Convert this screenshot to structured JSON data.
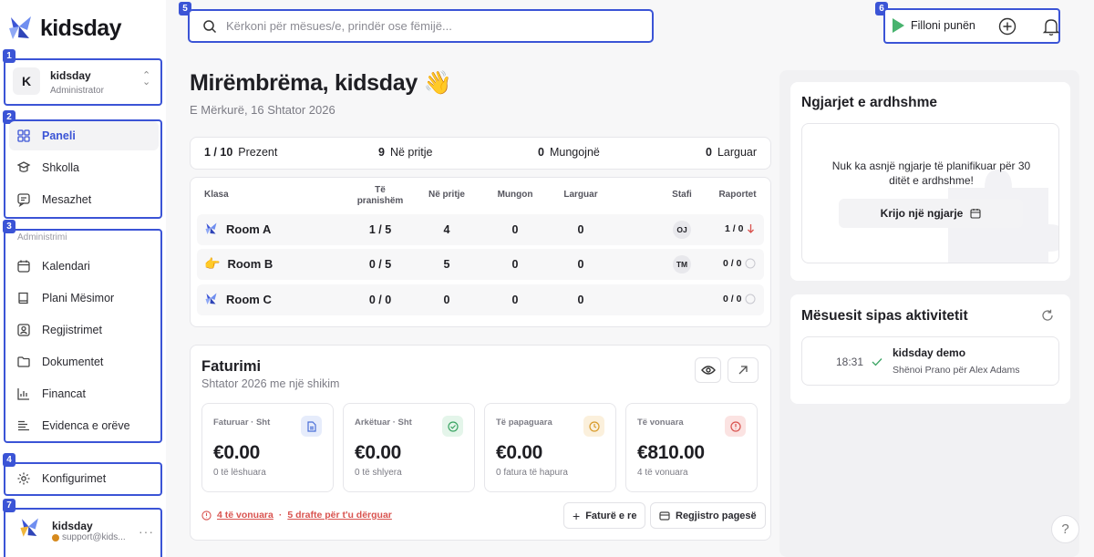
{
  "app": {
    "logo_text": "kidsday"
  },
  "annotations": [
    "1",
    "2",
    "3",
    "4",
    "5",
    "6",
    "7"
  ],
  "account": {
    "initial": "K",
    "name": "kidsday",
    "role": "Administrator"
  },
  "nav_main": [
    {
      "label": "Paneli",
      "icon": "grid-icon",
      "active": true
    },
    {
      "label": "Shkolla",
      "icon": "school-icon"
    },
    {
      "label": "Mesazhet",
      "icon": "message-icon"
    }
  ],
  "admin_section": {
    "label": "Administrimi"
  },
  "nav_admin": [
    {
      "label": "Kalendari",
      "icon": "calendar-icon"
    },
    {
      "label": "Plani Mësimor",
      "icon": "book-icon"
    },
    {
      "label": "Regjistrimet",
      "icon": "user-badge-icon"
    },
    {
      "label": "Dokumentet",
      "icon": "folder-icon"
    },
    {
      "label": "Financat",
      "icon": "chart-icon"
    },
    {
      "label": "Evidenca e orëve",
      "icon": "list-icon"
    }
  ],
  "settings": {
    "label": "Konfigurimet",
    "icon": "gear-icon"
  },
  "user": {
    "name": "kidsday",
    "email": "support@kids..."
  },
  "search": {
    "placeholder": "Kërkoni për mësues/e, prindër ose fëmijë..."
  },
  "topbar": {
    "start_label": "Filloni punën"
  },
  "greeting": {
    "title": "Mirëmbrëma, kidsday 👋",
    "date": "E Mërkurë, 16 Shtator 2026"
  },
  "stats": {
    "present_value": "1 / 10",
    "present_label": "Prezent",
    "waiting_value": "9",
    "waiting_label": "Në pritje",
    "absent_value": "0",
    "absent_label": "Mungojnë",
    "left_value": "0",
    "left_label": "Larguar"
  },
  "table": {
    "headers": {
      "class": "Klasa",
      "present_1": "Të",
      "present_2": "pranishëm",
      "waiting": "Në pritje",
      "absent": "Mungon",
      "left": "Larguar",
      "staff": "Stafi",
      "reports": "Raportet"
    },
    "rows": [
      {
        "room": "Room A",
        "present": "1 / 5",
        "waiting": "4",
        "absent": "0",
        "left": "0",
        "staff": "OJ",
        "reports": "1 / 0",
        "report_icon": "arrow-down-icon"
      },
      {
        "room": "Room B",
        "present": "0 / 5",
        "waiting": "5",
        "absent": "0",
        "left": "0",
        "staff": "TM",
        "reports": "0 / 0",
        "report_icon": "circle-icon"
      },
      {
        "room": "Room C",
        "present": "0 / 0",
        "waiting": "0",
        "absent": "0",
        "left": "0",
        "staff": "",
        "reports": "0 / 0",
        "report_icon": "circle-icon"
      }
    ]
  },
  "billing": {
    "title": "Faturimi",
    "subtitle": "Shtator 2026 me një shikim",
    "kpis": [
      {
        "label": "Faturuar · Sht",
        "value": "€0.00",
        "note": "0 të lëshuara",
        "icon": "document-icon",
        "color": "#4a6fd8",
        "bg": "#e6ecfb"
      },
      {
        "label": "Arkëtuar · Sht",
        "value": "€0.00",
        "note": "0 të shlyera",
        "icon": "check-circle-icon",
        "color": "#3aa463",
        "bg": "#e4f5ea"
      },
      {
        "label": "Të papaguara",
        "value": "€0.00",
        "note": "0 fatura të hapura",
        "icon": "clock-icon",
        "color": "#d89b2a",
        "bg": "#fbf0dc"
      },
      {
        "label": "Të vonuara",
        "value": "€810.00",
        "note": "4 të vonuara",
        "icon": "alert-icon",
        "color": "#d9534f",
        "bg": "#fbe3e2"
      }
    ],
    "warning_late": "4 të vonuara",
    "warning_sep": "·",
    "warning_drafts": "5 drafte për t'u dërguar",
    "new_invoice": "Faturë e re",
    "record_payment": "Regjistro pagesë"
  },
  "events": {
    "title": "Ngjarjet e ardhshme",
    "empty_text": "Nuk ka asnjë ngjarje të planifikuar për 30 ditët e ardhshme!",
    "create_label": "Krijo një ngjarje"
  },
  "activity": {
    "title": "Mësuesit sipas aktivitetit",
    "items": [
      {
        "time": "18:31",
        "name": "kidsday demo",
        "desc": "Shënoi Prano për Alex Adams"
      }
    ]
  },
  "help": {
    "label": "?"
  },
  "colors": {
    "accent": "#3b54d6",
    "green": "#48b36e",
    "red": "#d9534f"
  }
}
